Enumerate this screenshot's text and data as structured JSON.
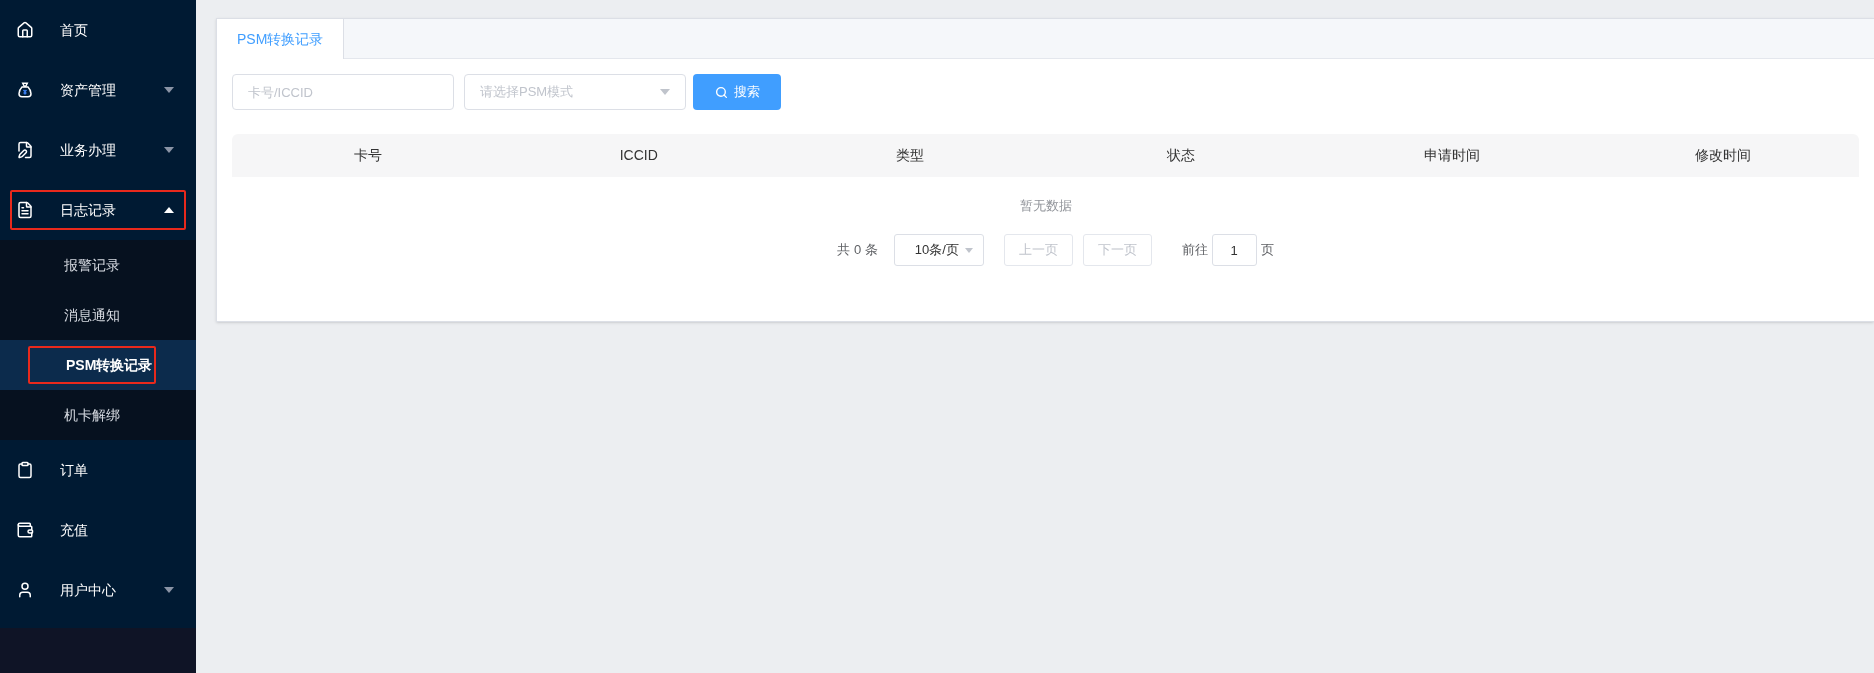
{
  "sidebar": {
    "items": [
      {
        "label": "首页",
        "kind": "link",
        "highlighted": false
      },
      {
        "label": "资产管理",
        "kind": "group",
        "expanded": false,
        "highlighted": false
      },
      {
        "label": "业务办理",
        "kind": "group",
        "expanded": false,
        "highlighted": false
      },
      {
        "label": "日志记录",
        "kind": "group",
        "expanded": true,
        "highlighted": true,
        "children": [
          {
            "label": "报警记录",
            "selected": false,
            "highlighted": false
          },
          {
            "label": "消息通知",
            "selected": false,
            "highlighted": false
          },
          {
            "label": "PSM转换记录",
            "selected": true,
            "highlighted": true
          },
          {
            "label": "机卡解绑",
            "selected": false,
            "highlighted": false
          }
        ]
      },
      {
        "label": "订单",
        "kind": "link",
        "highlighted": false
      },
      {
        "label": "充值",
        "kind": "link",
        "highlighted": false
      },
      {
        "label": "用户中心",
        "kind": "group",
        "expanded": false,
        "highlighted": false
      }
    ]
  },
  "tabs": [
    {
      "label": "PSM转换记录",
      "selected": true
    }
  ],
  "search": {
    "card_placeholder": "卡号/ICCID",
    "mode_placeholder": "请选择PSM模式",
    "button": "搜索"
  },
  "table": {
    "columns": [
      "卡号",
      "ICCID",
      "类型",
      "状态",
      "申请时间",
      "修改时间"
    ],
    "empty_text": "暂无数据"
  },
  "pagination": {
    "total": "共 0 条",
    "page_size": "10条/页",
    "prev": "上一页",
    "next": "下一页",
    "goto_label": "前往",
    "page": "1",
    "page_suffix": "页"
  }
}
